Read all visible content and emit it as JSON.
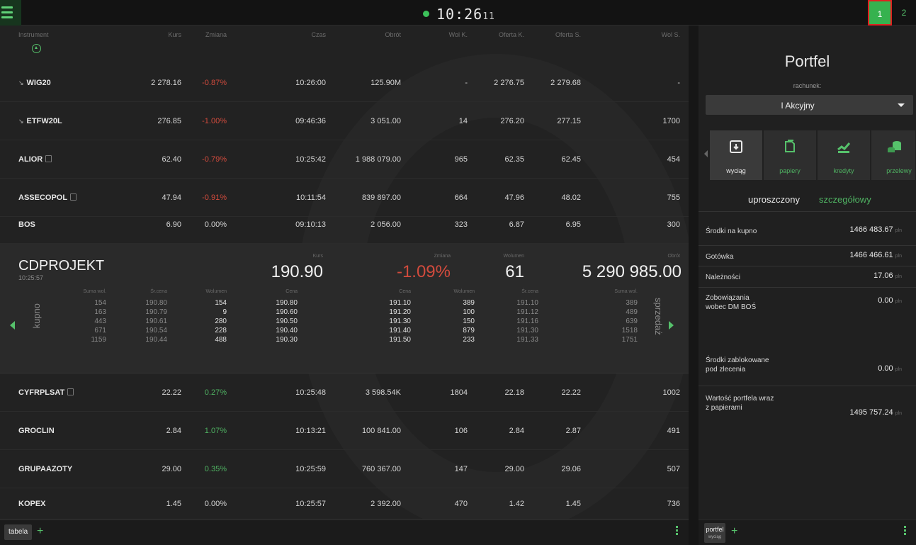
{
  "topbar": {
    "time_main": "10:26",
    "time_sec": "11",
    "workspace_tabs": [
      "1",
      "2"
    ]
  },
  "table": {
    "headers": [
      "Instrument",
      "Kurs",
      "Zmiana",
      "Czas",
      "Obrót",
      "Wol K.",
      "Oferta K.",
      "Oferta S.",
      "Wol S."
    ],
    "rows": [
      {
        "name": "WIG20",
        "kurs": "2 278.16",
        "zmiana": "-0.87%",
        "czas": "10:26:00",
        "obrot": "125.90M",
        "wolk": "-",
        "ofertak": "2 276.75",
        "ofertas": "2 279.68",
        "wols": "-",
        "dir": "neg"
      },
      {
        "name": "ETFW20L",
        "kurs": "276.85",
        "zmiana": "-1.00%",
        "czas": "09:46:36",
        "obrot": "3 051.00",
        "wolk": "14",
        "ofertak": "276.20",
        "ofertas": "277.15",
        "wols": "1700",
        "dir": "neg"
      },
      {
        "name": "ALIOR",
        "kurs": "62.40",
        "zmiana": "-0.79%",
        "czas": "10:25:42",
        "obrot": "1 988 079.00",
        "wolk": "965",
        "ofertak": "62.35",
        "ofertas": "62.45",
        "wols": "454",
        "dir": "neg"
      },
      {
        "name": "ASSECOPOL",
        "kurs": "47.94",
        "zmiana": "-0.91%",
        "czas": "10:11:54",
        "obrot": "839 897.00",
        "wolk": "664",
        "ofertak": "47.96",
        "ofertas": "48.02",
        "wols": "755",
        "dir": "neg"
      },
      {
        "name": "BOS",
        "kurs": "6.90",
        "zmiana": "0.00%",
        "czas": "09:10:13",
        "obrot": "2 056.00",
        "wolk": "323",
        "ofertak": "6.87",
        "ofertas": "6.95",
        "wols": "300",
        "dir": "flat"
      },
      {
        "name": "CYFRPLSAT",
        "kurs": "22.22",
        "zmiana": "0.27%",
        "czas": "10:25:48",
        "obrot": "3 598.54K",
        "wolk": "1804",
        "ofertak": "22.18",
        "ofertas": "22.22",
        "wols": "1002",
        "dir": "pos"
      },
      {
        "name": "GROCLIN",
        "kurs": "2.84",
        "zmiana": "1.07%",
        "czas": "10:13:21",
        "obrot": "100 841.00",
        "wolk": "106",
        "ofertak": "2.84",
        "ofertas": "2.87",
        "wols": "491",
        "dir": "pos"
      },
      {
        "name": "GRUPAAZOTY",
        "kurs": "29.00",
        "zmiana": "0.35%",
        "czas": "10:25:59",
        "obrot": "760 367.00",
        "wolk": "147",
        "ofertak": "29.00",
        "ofertas": "29.06",
        "wols": "507",
        "dir": "pos"
      },
      {
        "name": "KOPEX",
        "kurs": "1.45",
        "zmiana": "0.00%",
        "czas": "10:25:57",
        "obrot": "2 392.00",
        "wolk": "470",
        "ofertak": "1.42",
        "ofertas": "1.45",
        "wols": "736",
        "dir": "flat"
      }
    ]
  },
  "detail": {
    "name": "CDPROJEKT",
    "time": "10:25:57",
    "labels": {
      "kurs": "Kurs",
      "zmiana": "Zmiana",
      "wolumen": "Wolumen",
      "obrot": "Obrót"
    },
    "kurs": "190.90",
    "zmiana": "-1.09%",
    "wolumen": "61",
    "obrot": "5 290 985.00",
    "buy_label": "kupno",
    "sell_label": "sprzedaż",
    "ob_headers": [
      "Suma wol.",
      "Śr.cena",
      "Wolumen",
      "Cena",
      "Cena",
      "Wolumen",
      "Śr.cena",
      "Suma wol."
    ],
    "book": [
      [
        "154",
        "190.80",
        "154",
        "190.80",
        "191.10",
        "389",
        "191.10",
        "389"
      ],
      [
        "163",
        "190.79",
        "9",
        "190.60",
        "191.20",
        "100",
        "191.12",
        "489"
      ],
      [
        "443",
        "190.61",
        "280",
        "190.50",
        "191.30",
        "150",
        "191.16",
        "639"
      ],
      [
        "671",
        "190.54",
        "228",
        "190.40",
        "191.40",
        "879",
        "191.30",
        "1518"
      ],
      [
        "1159",
        "190.44",
        "488",
        "190.30",
        "191.50",
        "233",
        "191.33",
        "1751"
      ]
    ]
  },
  "left_footer": {
    "tab": "tabela"
  },
  "portfolio": {
    "title": "Portfel",
    "account_label": "rachunek:",
    "account_value": "I Akcyjny",
    "actions": [
      "wyciąg",
      "papiery",
      "kredyty",
      "przelewy"
    ],
    "view_simple": "uproszczony",
    "view_detail": "szczegółowy",
    "items": [
      {
        "label": "Środki na kupno",
        "value": "1466 483.67",
        "unit": "pln"
      },
      {
        "label": "Gotówka",
        "value": "1466 466.61",
        "unit": "pln"
      },
      {
        "label": "Należności",
        "value": "17.06",
        "unit": "pln"
      },
      {
        "label": "Zobowiązania wobec DM BOŚ",
        "value": "0.00",
        "unit": "pln"
      },
      {
        "label": "Środki zablokowane pod zlecenia",
        "value": "0.00",
        "unit": "pln"
      },
      {
        "label": "Wartość portfela wraz z papierami",
        "value": "1495 757.24",
        "unit": "pln"
      }
    ],
    "footer_tab": "portfel",
    "footer_tab_sub": "wyciąg"
  },
  "colors": {
    "accent": "#56c16b",
    "negative": "#d24b3d",
    "positive": "#4fb262"
  }
}
